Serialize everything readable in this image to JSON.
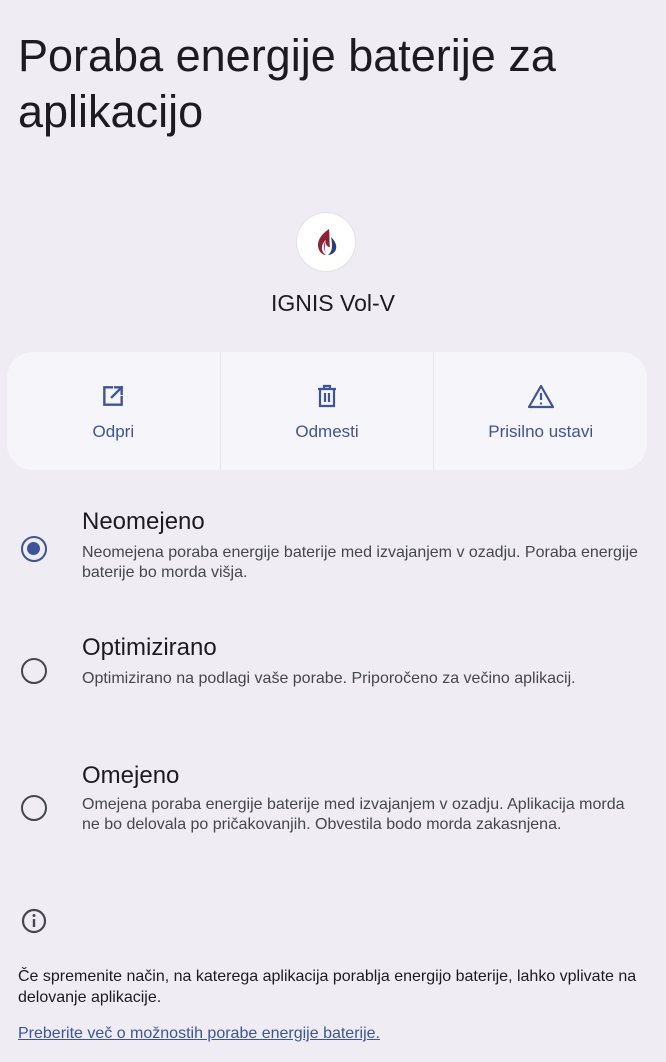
{
  "page": {
    "title": "Poraba energije baterije za aplikacijo"
  },
  "app": {
    "name": "IGNIS Vol-V",
    "icon": "flame-logo-icon"
  },
  "actions": [
    {
      "label": "Odpri",
      "icon": "open-external-icon"
    },
    {
      "label": "Odmesti",
      "icon": "trash-icon"
    },
    {
      "label": "Prisilno ustavi",
      "icon": "warning-icon"
    }
  ],
  "options": [
    {
      "title": "Neomejeno",
      "description": "Neomejena poraba energije baterije med izvajanjem v ozadju. Poraba energije baterije bo morda višja.",
      "selected": true
    },
    {
      "title": "Optimizirano",
      "description": "Optimizirano na podlagi vaše porabe. Priporočeno za večino aplikacij.",
      "selected": false
    },
    {
      "title": "Omejeno",
      "description": "Omejena poraba energije baterije med izvajanjem v ozadju. Aplikacija morda ne bo delovala po pričakovanjih. Obvestila bodo morda zakasnjena.",
      "selected": false
    }
  ],
  "footer": {
    "info_icon": "info-icon",
    "text": "Če spremenite način, na katerega aplikacija porablja energijo baterije, lahko vplivate na delovanje aplikacije.",
    "link": "Preberite več o možnostih porabe energije baterije."
  },
  "colors": {
    "background": "#efedf3",
    "accent": "#3d5496",
    "card": "#f6f5fa"
  }
}
